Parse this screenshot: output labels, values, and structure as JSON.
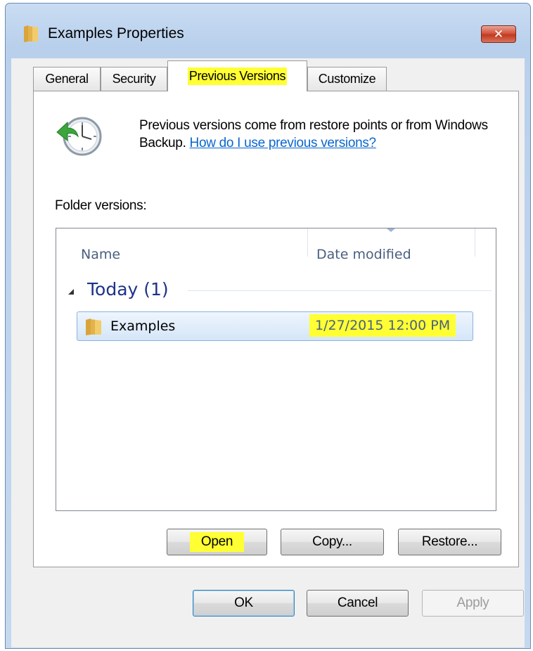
{
  "window": {
    "title": "Examples Properties",
    "close_glyph": "✕"
  },
  "tabs": [
    {
      "label": "General"
    },
    {
      "label": "Security"
    },
    {
      "label": "Previous Versions"
    },
    {
      "label": "Customize"
    }
  ],
  "active_tab": "Previous Versions",
  "panel": {
    "description": "Previous versions come from restore points or from Windows Backup.",
    "help_link": "How do I use previous versions?",
    "folder_versions_label": "Folder versions:"
  },
  "list": {
    "columns": [
      {
        "label": "Name"
      },
      {
        "label": "Date modified"
      }
    ],
    "group": {
      "label": "Today (1)"
    },
    "rows": [
      {
        "name": "Examples",
        "date_modified": "1/27/2015 12:00 PM"
      }
    ]
  },
  "panel_buttons": {
    "open": "Open",
    "copy": "Copy...",
    "restore": "Restore..."
  },
  "dialog_buttons": {
    "ok": "OK",
    "cancel": "Cancel",
    "apply": "Apply"
  },
  "colors": {
    "highlight": "#ffff33",
    "link": "#0a66cc",
    "titlebar": "#b9d0ec"
  },
  "icons": {
    "title": "folder-icon",
    "panel": "clock-restore-icon",
    "row": "folder-icon"
  }
}
